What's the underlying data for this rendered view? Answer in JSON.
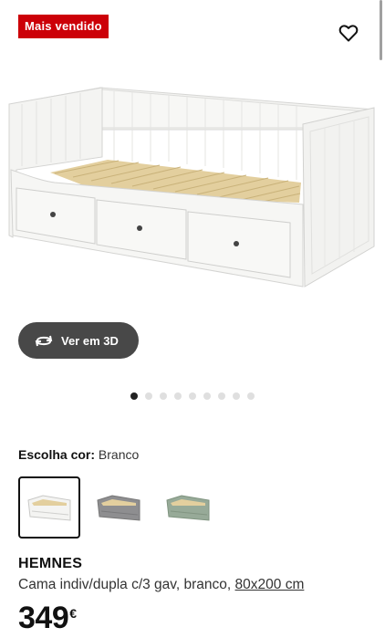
{
  "badge": "Mais vendido",
  "icons": {
    "favorite": "heart-outline-icon",
    "view3d": "rotate-3d-icon"
  },
  "view3d_label": "Ver em 3D",
  "gallery": {
    "total": 9,
    "active": 1
  },
  "color": {
    "label": "Escolha cor:",
    "value": "Branco"
  },
  "swatches": [
    {
      "name": "white",
      "color": "#f4f4f2",
      "selected": true
    },
    {
      "name": "grey",
      "color": "#8e8e90",
      "selected": false
    },
    {
      "name": "green",
      "color": "#97aa98",
      "selected": false
    }
  ],
  "product": {
    "brand": "HEMNES",
    "description": "Cama indiv/dupla c/3 gav, branco,",
    "size_link": "80x200 cm",
    "price": "349",
    "currency": "€"
  },
  "colors": {
    "badge": "#cc0008",
    "button_3d": "#484848",
    "slats": "#e3cf9e"
  }
}
